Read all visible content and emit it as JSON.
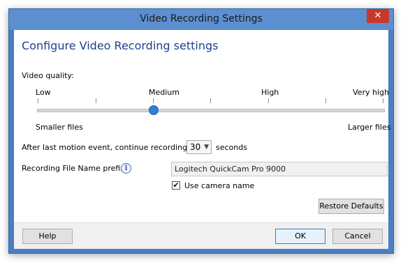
{
  "window": {
    "title": "Video Recording Settings",
    "close_glyph": "✕"
  },
  "heading": "Configure Video Recording settings",
  "quality": {
    "label": "Video quality:",
    "levels": [
      "Low",
      "Medium",
      "High",
      "Very high"
    ],
    "selected_level": "Medium",
    "left_caption": "Smaller files",
    "right_caption": "Larger files"
  },
  "motion": {
    "label": "After last motion event, continue recording for:",
    "value": "30",
    "unit": "seconds"
  },
  "prefix": {
    "label": "Recording File Name prefix:",
    "value": "Logitech QuickCam Pro 9000",
    "info_glyph": "i"
  },
  "camera_name": {
    "label": "Use camera name",
    "checked": true,
    "check_glyph": "✔"
  },
  "buttons": {
    "restore": "Restore Defaults",
    "help": "Help",
    "ok": "OK",
    "cancel": "Cancel"
  },
  "colors": {
    "border_blue": "#4a7fc0",
    "heading_blue": "#1f3f8f",
    "slider_thumb": "#2f7fd4",
    "close_red": "#c8392b"
  }
}
